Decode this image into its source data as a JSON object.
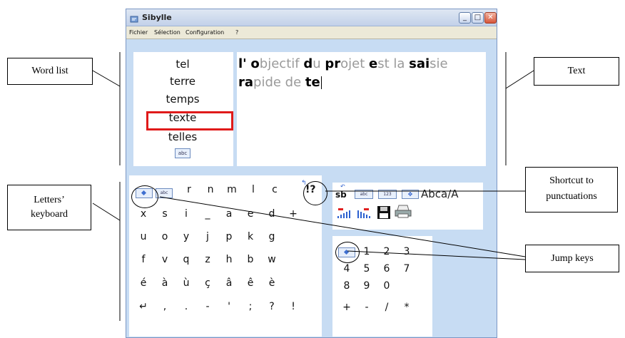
{
  "window": {
    "title": "Sibylle"
  },
  "menu": [
    "Fichier",
    "Sélection",
    "Configuration",
    "?"
  ],
  "word_list": [
    "tel",
    "terre",
    "temps",
    "texte",
    "telles"
  ],
  "word_list_selected_index": 3,
  "word_list_abc": "abc",
  "text": {
    "line1": [
      {
        "t": "l'",
        "s": "typed"
      },
      {
        "t": " ",
        "s": "plain"
      },
      {
        "t": "o",
        "s": "typed"
      },
      {
        "t": "bjectif ",
        "s": "pred"
      },
      {
        "t": "d",
        "s": "typed"
      },
      {
        "t": "u ",
        "s": "pred"
      },
      {
        "t": "pr",
        "s": "typed"
      },
      {
        "t": "ojet ",
        "s": "pred"
      },
      {
        "t": "e",
        "s": "typed"
      },
      {
        "t": "st la ",
        "s": "pred"
      },
      {
        "t": "sai",
        "s": "typed"
      },
      {
        "t": "sie",
        "s": "pred"
      }
    ],
    "line2": [
      {
        "t": "ra",
        "s": "typed"
      },
      {
        "t": "pide de ",
        "s": "pred"
      },
      {
        "t": "te",
        "s": "typed"
      }
    ]
  },
  "letters_keyboard": {
    "row1": [
      "r",
      "n",
      "m",
      "l",
      "c"
    ],
    "row1_abc": "abc",
    "punct_key": "!?",
    "row2": [
      "x",
      "s",
      "i",
      "_",
      "a",
      "e",
      "d",
      "+"
    ],
    "row3": [
      "u",
      "o",
      "y",
      "j",
      "p",
      "k",
      "g"
    ],
    "row4": [
      "f",
      "v",
      "q",
      "z",
      "h",
      "b",
      "w"
    ],
    "row5": [
      "é",
      "à",
      "ù",
      "ç",
      "â",
      "ê",
      "è"
    ],
    "row6": [
      "↵",
      ",",
      ".",
      "-",
      "'",
      ";",
      "?",
      "!"
    ]
  },
  "tools": {
    "abc_case": "Abca/A",
    "sb": "sb",
    "abc": "abc",
    "num": "123"
  },
  "numpad": {
    "row1": [
      "1",
      "2",
      "3"
    ],
    "row2": [
      "4",
      "5",
      "6",
      "7"
    ],
    "row3": [
      "8",
      "9",
      "0"
    ],
    "row4": [
      "+",
      "-",
      "/",
      "*"
    ]
  },
  "annotations": {
    "word_list": "Word list",
    "text": "Text",
    "letters": "Letters’ keyboard",
    "shortcut": "Shortcut to punctuations",
    "jump": "Jump keys"
  },
  "colors": {
    "typed": "#000000",
    "pred": "#9a9a9a",
    "highlight": "#e01a1a",
    "window_bg": "#c7dcf3"
  }
}
